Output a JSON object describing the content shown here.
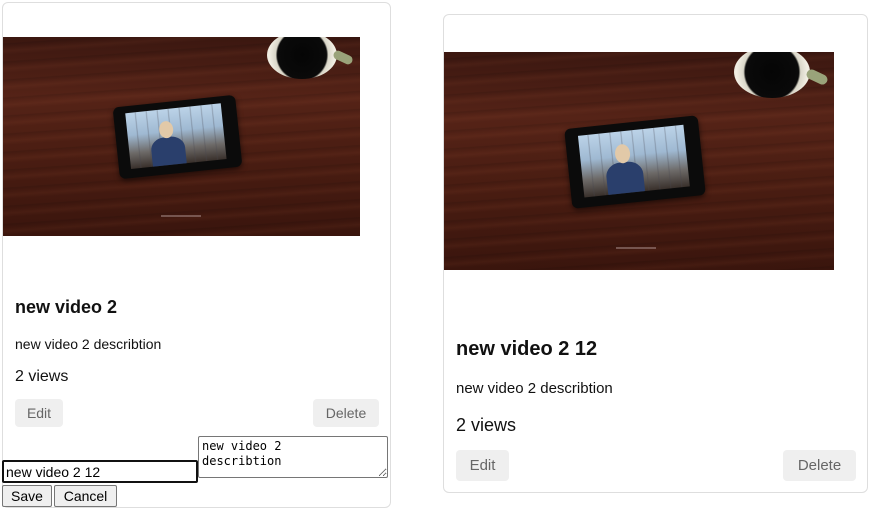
{
  "cards": [
    {
      "title": "new video 2",
      "description": "new video 2 describtion",
      "views": "2 views",
      "edit_label": "Edit",
      "delete_label": "Delete",
      "edit_form": {
        "title_value": "new video 2 12",
        "description_value": "new video 2\ndescribtion",
        "save_label": "Save",
        "cancel_label": "Cancel"
      }
    },
    {
      "title": "new video 2 12",
      "description": "new video 2 describtion",
      "views": "2 views",
      "edit_label": "Edit",
      "delete_label": "Delete"
    }
  ],
  "colors": {
    "card_border": "#dedede",
    "button_bg": "#efefef",
    "button_text": "#666666"
  }
}
